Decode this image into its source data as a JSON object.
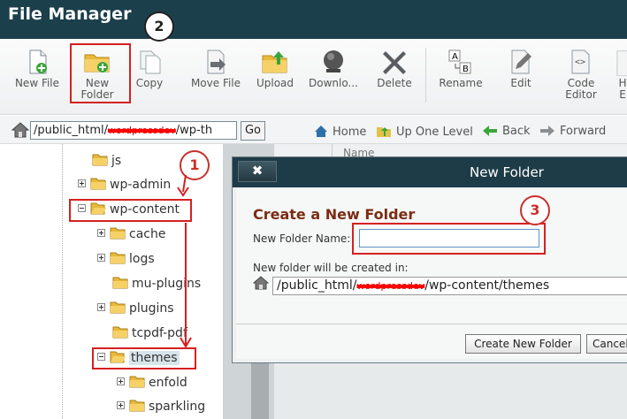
{
  "app": {
    "title": "File Manager"
  },
  "toolbar": [
    {
      "label": "New File",
      "icon": "new-file-icon"
    },
    {
      "label": "New\nFolder",
      "icon": "new-folder-icon"
    },
    {
      "label": "Copy",
      "icon": "copy-icon"
    },
    {
      "label": "Move File",
      "icon": "move-file-icon"
    },
    {
      "label": "Upload",
      "icon": "upload-icon"
    },
    {
      "label": "Downlo...",
      "icon": "download-icon"
    },
    {
      "label": "Delete",
      "icon": "delete-icon"
    },
    {
      "label": "Rename",
      "icon": "rename-icon"
    },
    {
      "label": "Edit",
      "icon": "edit-icon"
    },
    {
      "label": "Code\nEditor",
      "icon": "code-editor-icon"
    },
    {
      "label": "H\nE",
      "icon": "html-editor-icon"
    }
  ],
  "pathbar": {
    "path_prefix": "/public_html/",
    "path_redacted": "wordpressdev",
    "path_suffix": "/wp-th",
    "go_label": "Go",
    "nav": [
      {
        "label": "Home",
        "icon": "home-icon"
      },
      {
        "label": "Up One Level",
        "icon": "up-folder-icon"
      },
      {
        "label": "Back",
        "icon": "back-arrow-icon"
      },
      {
        "label": "Forward",
        "icon": "forward-arrow-icon"
      }
    ]
  },
  "tree": [
    {
      "label": "js",
      "expander": "none"
    },
    {
      "label": "wp-admin",
      "expander": "plus"
    },
    {
      "label": "wp-content",
      "expander": "minus"
    },
    {
      "label": "cache",
      "expander": "plus"
    },
    {
      "label": "logs",
      "expander": "plus"
    },
    {
      "label": "mu-plugins",
      "expander": "none"
    },
    {
      "label": "plugins",
      "expander": "plus"
    },
    {
      "label": "tcpdf-pdf",
      "expander": "none"
    },
    {
      "label": "themes",
      "expander": "minus",
      "selected": true
    },
    {
      "label": "enfold",
      "expander": "plus"
    },
    {
      "label": "sparkling",
      "expander": "plus"
    }
  ],
  "list": {
    "column_name": "Name"
  },
  "dialog": {
    "title": "New Folder",
    "close": "✖",
    "heading": "Create a New Folder",
    "name_label": "New Folder Name:",
    "name_value": "",
    "location_label": "New folder will be created in:",
    "location_prefix": "/public_html/",
    "location_redacted": "wordpressdev",
    "location_suffix": "/wp-content/themes",
    "create_button": "Create New Folder",
    "cancel_button": "Cancel"
  },
  "annotations": {
    "step1": "1",
    "step2": "2",
    "step3": "3"
  },
  "colors": {
    "header": "#1c3f4c",
    "dialog_title": "#1e3c48",
    "heading": "#7b2d14",
    "annotation_red": "#d62020"
  }
}
